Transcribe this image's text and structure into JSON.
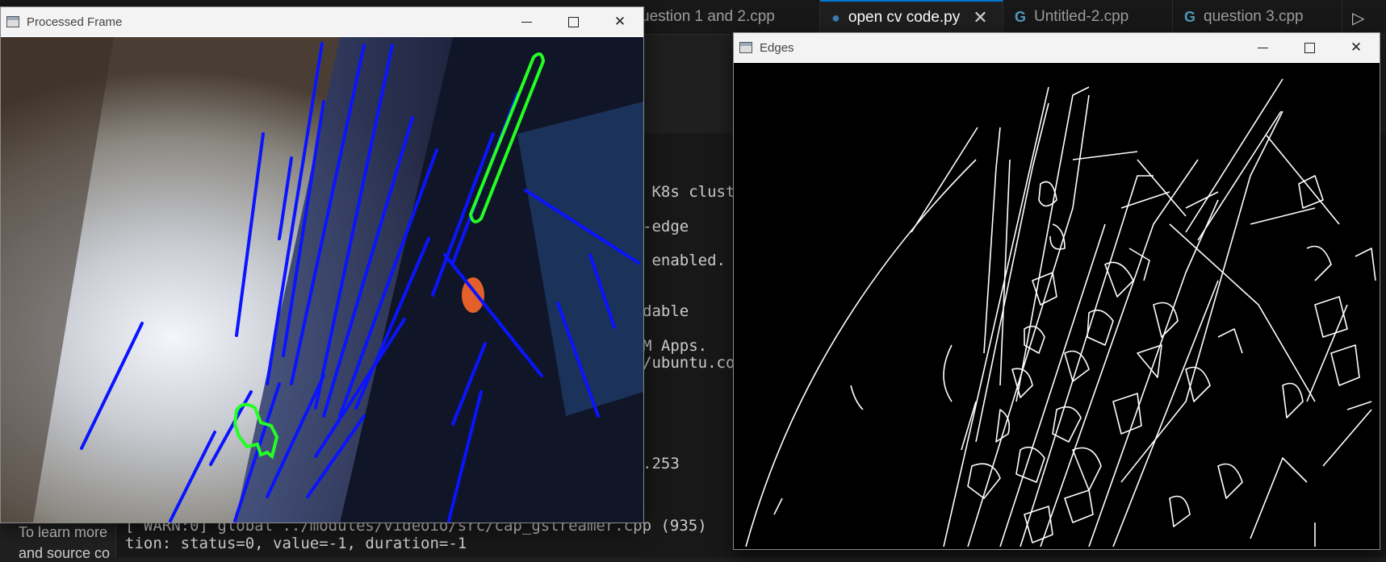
{
  "editor": {
    "tabs": [
      {
        "label": "uestion 1 and 2.cpp",
        "icon": "cpp-icon"
      },
      {
        "label": "open cv code.py",
        "icon": "python-icon",
        "active": true
      },
      {
        "label": "Untitled-2.cpp",
        "icon": "cpp-icon"
      },
      {
        "label": "question 3.cpp",
        "icon": "cpp-icon"
      }
    ],
    "close_glyph": "✕",
    "play_glyph": "▷"
  },
  "terminal": {
    "lines": [
      " K8s clust",
      "-edge",
      " enabled.",
      "dable",
      "M Apps.",
      "/ubuntu.co",
      ".253",
      "[ WARN:0] global ../modules/videoio/src/cap_gstreamer.cpp (935)",
      "tion: status=0, value=-1, duration=-1"
    ]
  },
  "side_panel": {
    "line1": "To learn more",
    "line2": "and source co"
  },
  "windows": {
    "processed": {
      "title": "Processed Frame",
      "controls": [
        "minimize",
        "maximize",
        "close"
      ]
    },
    "edges": {
      "title": "Edges",
      "controls": [
        "minimize",
        "maximize",
        "close"
      ]
    }
  },
  "colors": {
    "hough_lines": "#0a14ff",
    "contours": "#22ff22",
    "edges": "#ffffff",
    "editor_bg": "#1e1e1e",
    "accent": "#0078d4"
  }
}
